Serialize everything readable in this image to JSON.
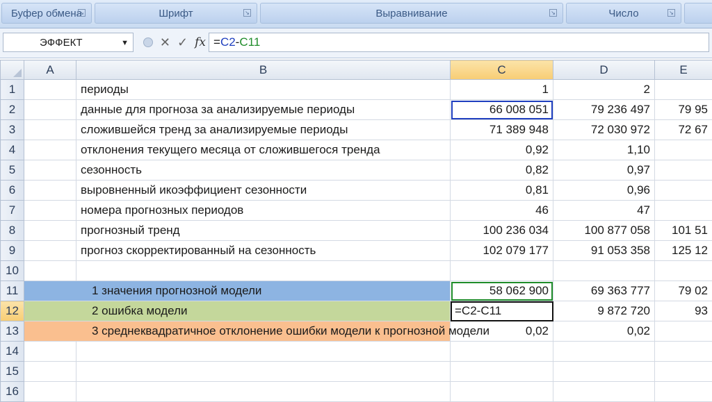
{
  "ribbon": {
    "groups": [
      {
        "label": "Буфер обмена"
      },
      {
        "label": "Шрифт"
      },
      {
        "label": "Выравнивание"
      },
      {
        "label": "Число"
      }
    ],
    "launcher_icon": "dialog-launcher-icon"
  },
  "formula_bar": {
    "name_box": "ЭФФЕКТ",
    "fx_symbol": "fx",
    "cancel_symbol": "✕",
    "enter_symbol": "✓",
    "formula_prefix": "=",
    "formula_ref1": "C2",
    "formula_op": "-",
    "formula_ref2": "C11"
  },
  "columns": [
    "A",
    "B",
    "C",
    "D",
    "E"
  ],
  "rows": [
    {
      "n": "1",
      "a": "",
      "b": "периоды",
      "c": "1",
      "d": "2",
      "e": ""
    },
    {
      "n": "2",
      "a": "",
      "b": "данные для прогноза за анализируемые периоды",
      "c": "66 008 051",
      "d": "79 236 497",
      "e": "79 95"
    },
    {
      "n": "3",
      "a": "",
      "b": "сложившейся тренд за анализируемые периоды",
      "c": "71 389 948",
      "d": "72 030 972",
      "e": "72 67"
    },
    {
      "n": "4",
      "a": "",
      "b": "отклонения текущего месяца от сложившегося тренда",
      "c": "0,92",
      "d": "1,10",
      "e": ""
    },
    {
      "n": "5",
      "a": "",
      "b": "сезонность",
      "c": "0,82",
      "d": "0,97",
      "e": ""
    },
    {
      "n": "6",
      "a": "",
      "b": "выровненный икоэффициент сезонности",
      "c": "0,81",
      "d": "0,96",
      "e": ""
    },
    {
      "n": "7",
      "a": "",
      "b": "номера прогнозных периодов",
      "c": "46",
      "d": "47",
      "e": ""
    },
    {
      "n": "8",
      "a": "",
      "b": "прогнозный тренд",
      "c": "100 236 034",
      "d": "100 877 058",
      "e": "101 51"
    },
    {
      "n": "9",
      "a": "",
      "b": "прогноз скорректированный на сезонность",
      "c": "102 079 177",
      "d": "91 053 358",
      "e": "125 12"
    },
    {
      "n": "10",
      "a": "",
      "b": "",
      "c": "",
      "d": "",
      "e": ""
    },
    {
      "n": "11",
      "a": "",
      "b": "1 значения прогнозной модели",
      "c": "58 062 900",
      "d": "69 363 777",
      "e": "79 02"
    },
    {
      "n": "12",
      "a": "",
      "b": "2 ошибка модели",
      "c": "=C2-C11",
      "d": "9 872 720",
      "e": "93"
    },
    {
      "n": "13",
      "a": "",
      "b": "3 среднеквадратичное отклонение ошибки модели к прогнозной модели",
      "c": "0,02",
      "d": "0,02",
      "e": ""
    },
    {
      "n": "14",
      "a": "",
      "b": "",
      "c": "",
      "d": "",
      "e": ""
    },
    {
      "n": "15",
      "a": "",
      "b": "",
      "c": "",
      "d": "",
      "e": ""
    },
    {
      "n": "16",
      "a": "",
      "b": "",
      "c": "",
      "d": "",
      "e": ""
    }
  ],
  "colors": {
    "row11_fill": "#8db4e2",
    "row12_fill": "#c4d79b",
    "row13_fill": "#fabf8f",
    "ref_c2": "#1f3fbf",
    "ref_c11": "#1f8c2a",
    "selected_header": "#f8cd74"
  }
}
